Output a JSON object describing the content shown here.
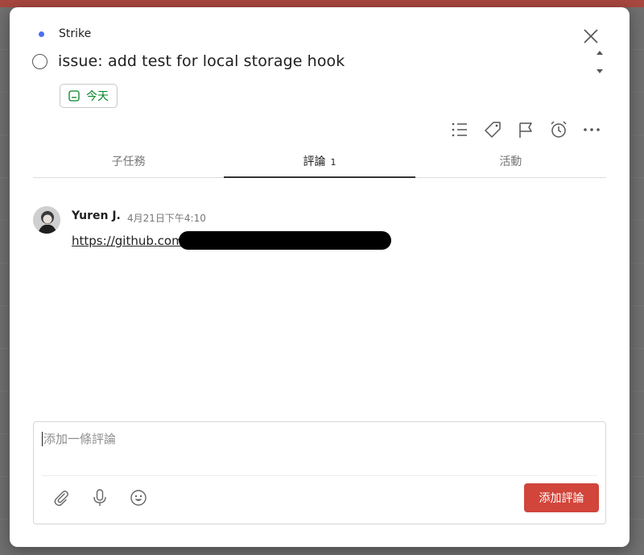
{
  "task": {
    "project_name": "Strike",
    "project_color": "#4c6ef5",
    "title": "issue: add test for local storage hook",
    "due_label": "今天",
    "due_color": "#058527"
  },
  "toolbar_icons": [
    "subtasks-list-icon",
    "label-tag-icon",
    "priority-flag-icon",
    "reminder-alarm-icon",
    "more-icon"
  ],
  "tabs": [
    {
      "label": "子任務",
      "count": ""
    },
    {
      "label": "評論",
      "count": "1"
    },
    {
      "label": "活動",
      "count": ""
    }
  ],
  "comments": [
    {
      "author": "Yuren J.",
      "time": "4月21日下午4:10",
      "text": "https://github.com/"
    }
  ],
  "composer": {
    "placeholder": "添加一條評論",
    "submit_label": "添加評論",
    "accent": "#d1453b"
  }
}
